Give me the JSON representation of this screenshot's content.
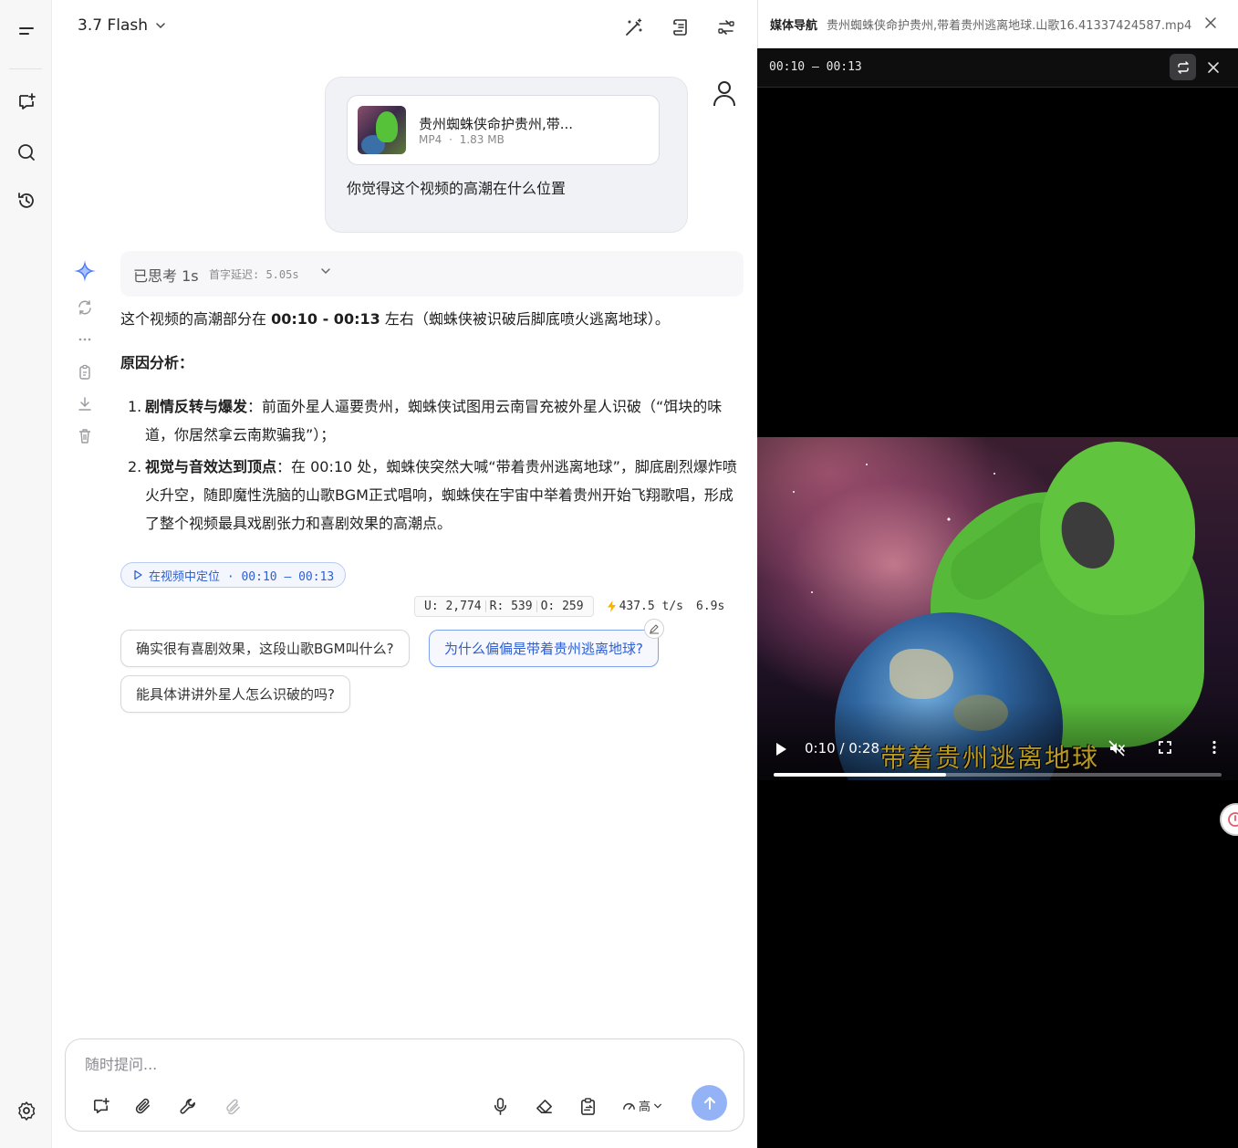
{
  "sidebar": {
    "icons": [
      "menu-icon",
      "new-chat-icon",
      "search-icon",
      "history-icon",
      "settings-icon"
    ]
  },
  "header": {
    "model_name": "3.7 Flash"
  },
  "user_message": {
    "file_name": "贵州蜘蛛侠命护贵州,带...",
    "file_type": "MP4",
    "file_size": "1.83 MB",
    "text": "你觉得这个视频的高潮在什么位置"
  },
  "assistant": {
    "think_label": "已思考 1s",
    "latency": "首字延迟: 5.05s",
    "intro_pre": "这个视频的高潮部分在 ",
    "intro_bold": "00:10 - 00:13",
    "intro_post": " 左右（蜘蛛侠被识破后脚底喷火逃离地球）。",
    "reasons_title": "原因分析：",
    "items": [
      {
        "num": "1.",
        "bold": "剧情反转与爆发",
        "text": "：前面外星人逼要贵州，蜘蛛侠试图用云南冒充被外星人识破（“饵块的味道，你居然拿云南欺骗我”）；"
      },
      {
        "num": "2.",
        "bold": "视觉与音效达到顶点",
        "text": "：在 00:10 处，蜘蛛侠突然大喊“带着贵州逃离地球”，脚底剧烈爆炸喷火升空，随即魔性洗脑的山歌BGM正式唱响，蜘蛛侠在宇宙中举着贵州开始飞翔歌唱，形成了整个视频最具戏剧张力和喜剧效果的高潮点。"
      }
    ],
    "locate_chip": "在视频中定位 · 00:10 – 00:13",
    "stats": {
      "u": "U: 2,774",
      "r": "R: 539",
      "o": "O: 259",
      "speed": "437.5 t/s",
      "time": "6.9s"
    },
    "suggestions": [
      "确实很有喜剧效果，这段山歌BGM叫什么?",
      "为什么偏偏是带着贵州逃离地球?",
      "能具体讲讲外星人怎么识破的吗?"
    ]
  },
  "composer": {
    "placeholder": "随时提问...",
    "effort": "高"
  },
  "media_panel": {
    "title": "媒体导航",
    "file_name": "贵州蜘蛛侠命护贵州,带着贵州逃离地球.山歌16.41337424587.mp4",
    "segment": "00:10 – 00:13",
    "video_subtitle": "带着贵州逃离地球",
    "current_time": "0:10",
    "duration": "0:28",
    "progress_fraction": 0.385
  },
  "colors": {
    "accent": "#2f5fd0",
    "send_button": "#94b3f7"
  }
}
